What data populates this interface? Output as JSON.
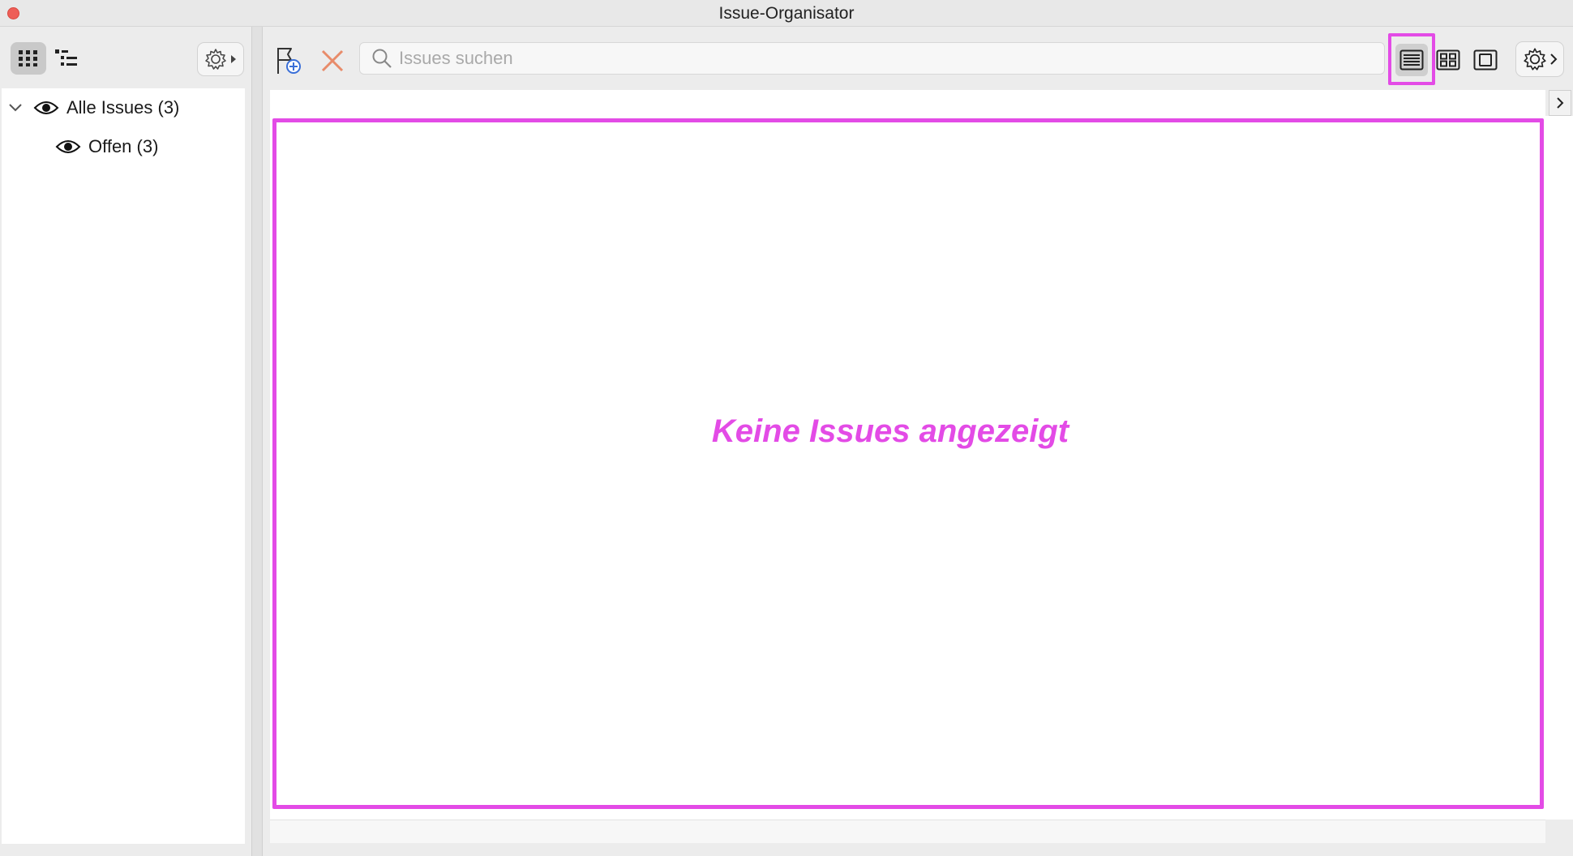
{
  "window": {
    "title": "Issue-Organisator"
  },
  "sidebar": {
    "view_modes": [
      {
        "name": "grid-view",
        "icon": "grid-icon",
        "active": true
      },
      {
        "name": "tree-view",
        "icon": "tree-list-icon",
        "active": false
      }
    ],
    "settings_icon": "gear-icon",
    "tree": [
      {
        "label": "Alle Issues (3)",
        "icon": "eye-icon",
        "expanded": true,
        "level": 0
      },
      {
        "label": "Offen (3)",
        "icon": "eye-icon",
        "level": 1
      }
    ]
  },
  "toolbar": {
    "new_issue_icon": "flag-add-icon",
    "delete_icon": "close-icon",
    "search": {
      "placeholder": "Issues suchen",
      "value": ""
    },
    "layouts": [
      {
        "name": "list-layout",
        "icon": "list-icon",
        "active": true
      },
      {
        "name": "tiles-layout",
        "icon": "tiles-icon",
        "active": false
      },
      {
        "name": "single-layout",
        "icon": "single-frame-icon",
        "active": false
      }
    ],
    "settings_icon": "gear-icon"
  },
  "content": {
    "empty_message": "Keine Issues angezeigt",
    "highlight_color": "#e34be6"
  }
}
